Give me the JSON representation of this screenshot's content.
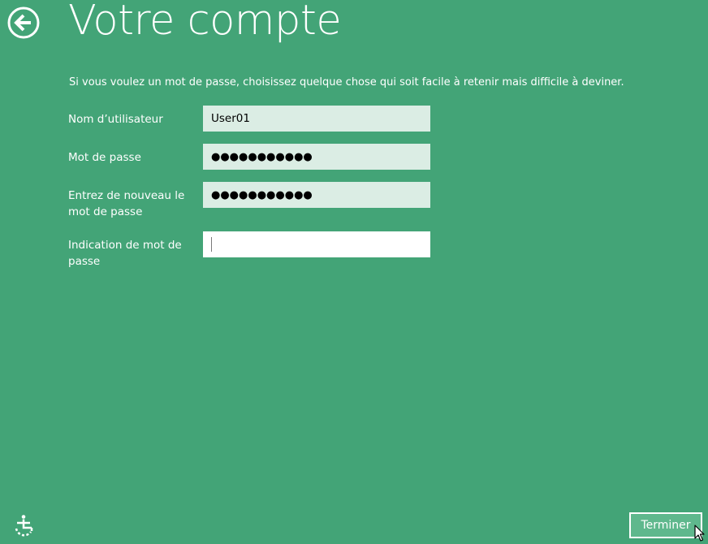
{
  "header": {
    "title": "Votre compte",
    "back_icon": "back-arrow-icon"
  },
  "intro_text": "Si vous voulez un mot de passe, choisissez quelque chose qui soit facile à retenir mais difficile à deviner.",
  "form": {
    "username": {
      "label": "Nom d’utilisateur",
      "value": "User01"
    },
    "password": {
      "label": "Mot de passe",
      "value": "●●●●●●●●●●●"
    },
    "confirm_password": {
      "label": "Entrez de nouveau le mot de passe",
      "value": "●●●●●●●●●●●"
    },
    "hint": {
      "label": "Indication de mot de passe",
      "value": ""
    }
  },
  "footer": {
    "ease_of_access_icon": "ease-of-access-icon",
    "finish_label": "Terminer"
  },
  "colors": {
    "background": "#43a477",
    "field_background": "#dbede4",
    "active_field_background": "#ffffff",
    "text": "#ffffff"
  }
}
